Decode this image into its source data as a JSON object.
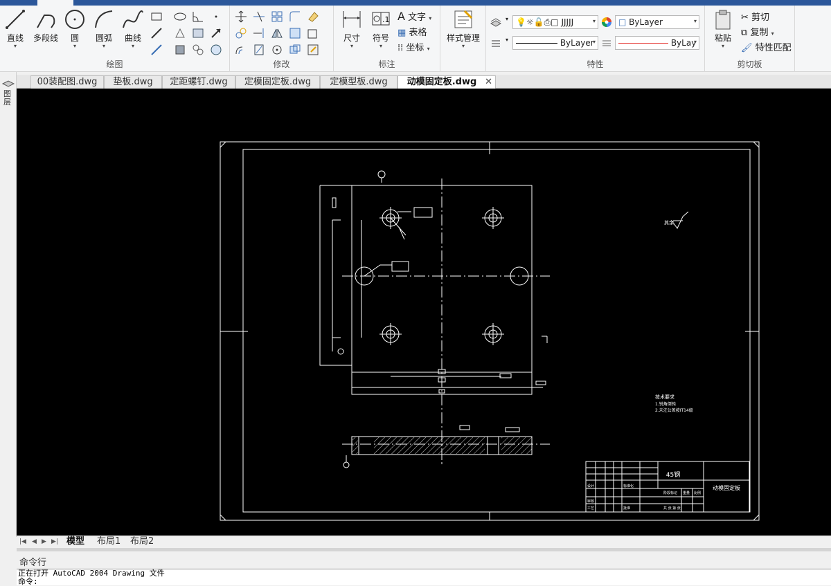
{
  "ribbon": {
    "draw": {
      "title": "绘图",
      "line": "直线",
      "polyline": "多段线",
      "circle": "圆",
      "arc": "圆弧",
      "curve": "曲线"
    },
    "modify": {
      "title": "修改"
    },
    "annotation": {
      "title": "标注",
      "dimension": "尺寸",
      "symbol": "符号",
      "text": "文字",
      "table": "表格",
      "coord": "坐标"
    },
    "style": {
      "label": "样式管理"
    },
    "properties": {
      "title": "特性",
      "layer_name": "JJJJJ",
      "color": "ByLayer",
      "linetype": "ByLayer",
      "lineweight": "ByLay"
    },
    "clipboard": {
      "title": "剪切板",
      "paste": "粘贴",
      "cut": "剪切",
      "copy": "复制",
      "match": "特性匹配"
    }
  },
  "left_strip": {
    "label": "图层"
  },
  "doc_tabs": [
    {
      "label": "00装配图.dwg"
    },
    {
      "label": "垫板.dwg"
    },
    {
      "label": "定距螺钉.dwg"
    },
    {
      "label": "定模固定板.dwg"
    },
    {
      "label": "定模型板.dwg"
    },
    {
      "label": "动模固定板.dwg",
      "active": true
    }
  ],
  "drawing": {
    "material": "45钢",
    "part_name": "动模固定板",
    "surface_note": "其余",
    "tech_req_title": "技术要求",
    "tech_req_1": "1.锐角倒钝",
    "tech_req_2": "2.未注公差按IT14级",
    "tb_design": "设计",
    "tb_review": "审核",
    "tb_process": "工艺",
    "tb_approve": "批准",
    "tb_stage": "阶段标记",
    "tb_weight": "重量",
    "tb_scale": "比例",
    "tb_sheet": "共 张 第 张",
    "tb_std": "标准化"
  },
  "layout_tabs": [
    {
      "label": "模型",
      "active": true
    },
    {
      "label": "布局1"
    },
    {
      "label": "布局2"
    }
  ],
  "command": {
    "label": "命令行",
    "line1": "正在打开 AutoCAD 2004 Drawing 文件",
    "line2": "命令:"
  },
  "colors": {
    "accent": "#2b579a",
    "canvas_bg": "#000000",
    "linetype_red": "#e53935"
  }
}
